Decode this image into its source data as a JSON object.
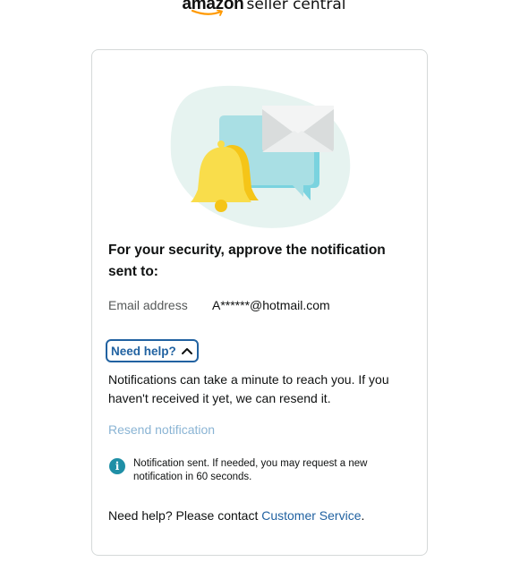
{
  "logo": {
    "brand": "amazon",
    "product": "seller central"
  },
  "heading": "For your security, approve the notification sent to:",
  "email": {
    "label": "Email address",
    "value": "A******@hotmail.com"
  },
  "need_help": {
    "label": "Need help?",
    "icon": "chevron-up-icon"
  },
  "notification_message": "Notifications can take a minute to reach you. If you haven't received it yet, we can resend it.",
  "resend_label": "Resend notification",
  "info_alert": {
    "icon": "info-icon",
    "glyph": "i",
    "text": "Notification sent. If needed, you may request a new notification in 60 seconds."
  },
  "contact": {
    "prefix": "Need help? Please contact ",
    "link_label": "Customer Service",
    "suffix": "."
  },
  "colors": {
    "link": "#2162a1",
    "link_disabled": "#8ab4d4",
    "info": "#1f8fa6",
    "logo_smile": "#ff9900"
  }
}
